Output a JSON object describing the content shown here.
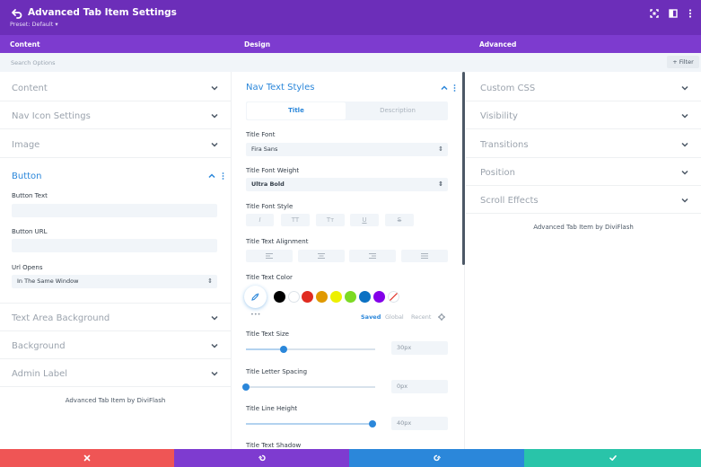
{
  "header": {
    "title": "Advanced Tab Item Settings",
    "preset": "Preset: Default ▾",
    "icons": [
      "back-arrow-icon",
      "expand-icon",
      "split-view-icon",
      "more-vertical-icon"
    ]
  },
  "tabs": [
    {
      "label": "Content",
      "active": true
    },
    {
      "label": "Design",
      "active": false
    },
    {
      "label": "Advanced",
      "active": false
    }
  ],
  "search": {
    "placeholder": "Search Options",
    "filter_label": "+ Filter"
  },
  "left": {
    "toggles": [
      "Content",
      "Nav Icon Settings",
      "Image"
    ],
    "button_section": {
      "title": "Button",
      "button_text_label": "Button Text",
      "button_text_value": "",
      "button_url_label": "Button URL",
      "button_url_value": "",
      "url_opens_label": "Url Opens",
      "url_opens_value": "In The Same Window"
    },
    "toggles_after": [
      "Text Area Background",
      "Background",
      "Admin Label"
    ],
    "credit": "Advanced Tab Item by DiviFlash"
  },
  "middle": {
    "section_title": "Nav Text Styles",
    "subtabs": [
      "Title",
      "Description"
    ],
    "title_font_label": "Title Font",
    "title_font_value": "Fira Sans",
    "font_weight_label": "Title Font Weight",
    "font_weight_value": "Ultra Bold",
    "font_style_label": "Title Font Style",
    "font_style_buttons": [
      "I",
      "TT",
      "Tт",
      "U",
      "S"
    ],
    "alignment_label": "Title Text Alignment",
    "alignment_icons": [
      "align-left-icon",
      "align-center-icon",
      "align-right-icon",
      "align-justify-icon"
    ],
    "text_color_label": "Title Text Color",
    "swatches": [
      "#000000",
      "#ffffff",
      "#e02b20",
      "#e09900",
      "#edf000",
      "#7cda24",
      "#0c71c3",
      "#8300e9"
    ],
    "palette_tabs": [
      "Saved",
      "Global",
      "Recent"
    ],
    "more_dots": "•••",
    "text_size_label": "Title Text Size",
    "text_size_value": "30px",
    "text_size_fraction": 0.29,
    "letter_spacing_label": "Title Letter Spacing",
    "letter_spacing_value": "0px",
    "letter_spacing_fraction": 0.0,
    "line_height_label": "Title Line Height",
    "line_height_value": "40px",
    "line_height_fraction": 0.98,
    "text_shadow_label": "Title Text Shadow"
  },
  "right": {
    "toggles": [
      "Custom CSS",
      "Visibility",
      "Transitions",
      "Position",
      "Scroll Effects"
    ],
    "credit": "Advanced Tab Item by DiviFlash"
  },
  "footer": {
    "buttons": [
      {
        "name": "discard",
        "color": "#ef5555"
      },
      {
        "name": "undo",
        "color": "#7e3bd0"
      },
      {
        "name": "redo",
        "color": "#2b87da"
      },
      {
        "name": "save",
        "color": "#29c4a9"
      }
    ]
  },
  "colors": {
    "accent": "#2b87da",
    "header": "#6c2eb9",
    "tabbar": "#7d3bcf"
  }
}
